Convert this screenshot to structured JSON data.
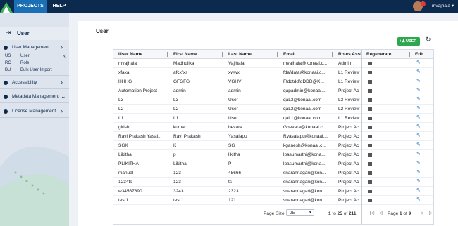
{
  "topbar": {
    "tabs": [
      {
        "label": "PROJECTS",
        "active": true
      },
      {
        "label": "HELP",
        "active": false
      }
    ],
    "notification_count": "1",
    "username": "mvajhala"
  },
  "sidebar": {
    "title": "User",
    "user_management": "User Management",
    "sub_items": [
      {
        "code": "US",
        "label": "User"
      },
      {
        "code": "RO",
        "label": "Role"
      },
      {
        "code": "BU",
        "label": "Bulk User Import"
      }
    ],
    "accessibility": "Accessibility",
    "metadata_management": "Metadata Management",
    "license_management": "License Management"
  },
  "main": {
    "title": "User",
    "add_user_label": "USER",
    "columns": [
      "User Name",
      "First Name",
      "Last Name",
      "Email",
      "Roles Assig",
      "Regenerate",
      "Edit"
    ],
    "rows": [
      [
        "mvajhala",
        "Madhulika",
        "Vajjhala",
        "mvajhala@konaai.c...",
        "Admin"
      ],
      [
        "xfaxa",
        "afcxfxs",
        "xwwx",
        "fdafdafa@konaai.c...",
        "L1 Review"
      ],
      [
        "HHHG",
        "GFGFG",
        "VGHV",
        "FfddtddfdDDD@K...",
        "L1 Review"
      ],
      [
        "Automation Project",
        "admin",
        "admin",
        "qapadmin@konaai....",
        "Project Ac"
      ],
      [
        "L3",
        "L3",
        "User",
        "qaL3@konaai.com",
        "L3 Review"
      ],
      [
        "L2",
        "L2",
        "User",
        "qaL2@konaai.com",
        "L2 Review"
      ],
      [
        "L1",
        "L1",
        "User",
        "qaL1@konaai.com",
        "L1 Review"
      ],
      [
        "girish",
        "kumar",
        "bevara",
        "Gbevara@konaai.c...",
        "Project Ac"
      ],
      [
        "Ravi Prakash Yasal...",
        "Ravi Prakash",
        "Yasalapu",
        "Ryasalapu@konaai....",
        "Project Ac"
      ],
      [
        "SGK",
        "K",
        "SG",
        "kganesh@konaai.c...",
        "Project Ac"
      ],
      [
        "Likitha",
        "p",
        "likitha",
        "lpasumarthi@kona...",
        "Project Ac"
      ],
      [
        "PLIKITHA",
        "Likitha",
        "P",
        "lpasumarthi@kona...",
        "Project Ac"
      ],
      [
        "manual",
        "123",
        "45666",
        "snarannagari@kon...",
        "Project Ac"
      ],
      [
        "1234ts",
        "123",
        "ts",
        "snarannagari@kon...",
        "Project Ac"
      ],
      [
        "w34567890",
        "3243",
        "2323",
        "snarannagari@kon...",
        "Project Ac"
      ],
      [
        "test1",
        "test1",
        "121",
        "snarannagari@kon...",
        "Project Ac"
      ]
    ]
  },
  "pager": {
    "page_size_label": "Page Size:",
    "page_size_value": "25",
    "range_from": "1",
    "range_to": "25",
    "range_total": "211",
    "range_to_word": "to",
    "range_of_word": "of",
    "page_word": "Page",
    "page_current": "1",
    "page_total": "9",
    "page_of_word": "of"
  },
  "colors": {
    "navy": "#0c2a4d",
    "accent": "#1a6fb5",
    "green": "#2ea84f"
  }
}
